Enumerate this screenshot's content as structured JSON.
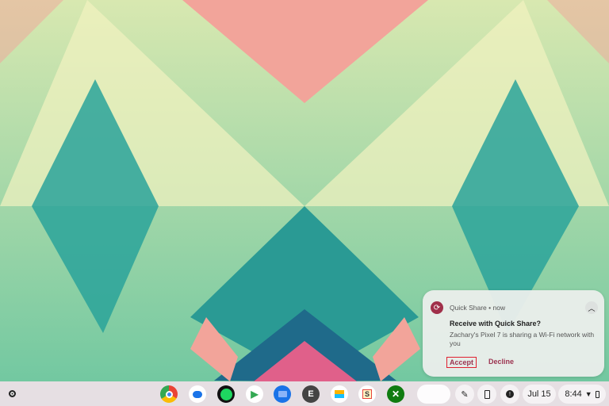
{
  "notification": {
    "app": "Quick Share",
    "separator": "•",
    "time": "now",
    "title": "Receive with Quick Share?",
    "message": "Zachary's Pixel 7 is sharing a Wi-Fi network with you",
    "accept_label": "Accept",
    "decline_label": "Decline",
    "collapse_icon": "chevron-up-icon"
  },
  "shelf": {
    "apps": [
      {
        "name": "chrome",
        "color": "#4285f4"
      },
      {
        "name": "messages",
        "color": "#1a73e8"
      },
      {
        "name": "spotify",
        "color": "#111111"
      },
      {
        "name": "play-store",
        "color": "#ffffff"
      },
      {
        "name": "files",
        "color": "#1a73e8"
      },
      {
        "name": "e-app",
        "label": "E",
        "color": "#444444"
      },
      {
        "name": "airtable",
        "color": "#ffffff"
      },
      {
        "name": "slides-app",
        "color": "#ffffff"
      },
      {
        "name": "xbox",
        "color": "#107c10"
      }
    ],
    "date": "Jul 15",
    "time": "8:44"
  }
}
